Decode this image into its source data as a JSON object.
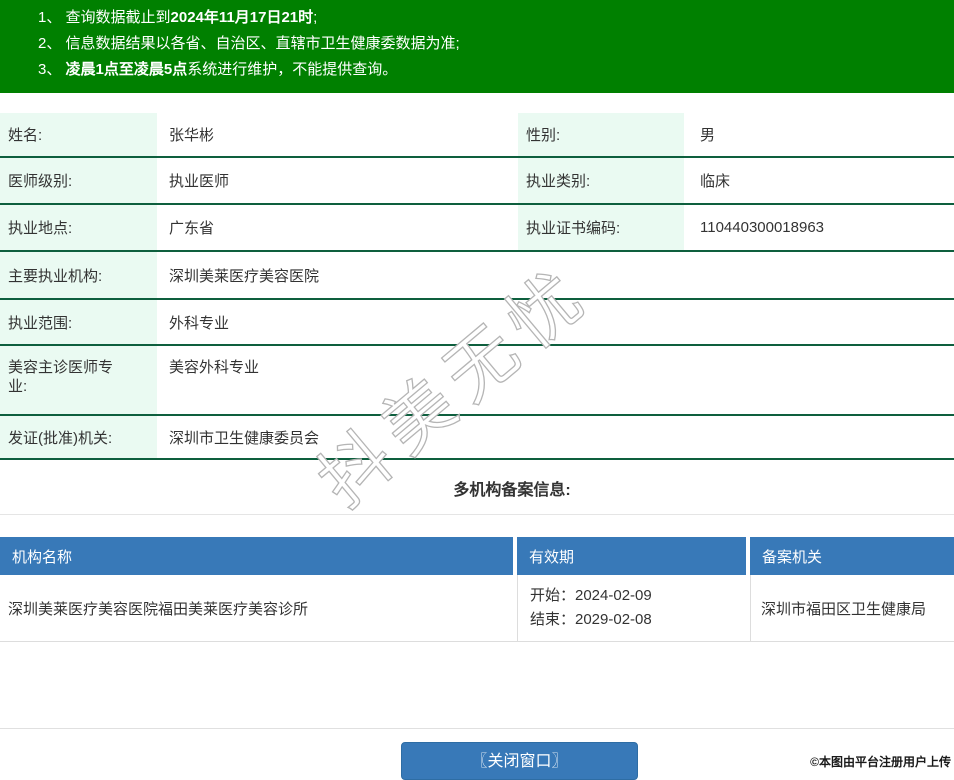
{
  "notices": {
    "items": [
      {
        "num": "1、",
        "pre": "查询数据截止到",
        "bold": "2024年11月17日21时",
        "post": ";"
      },
      {
        "num": "2、",
        "pre": "信息数据结果以各省、自治区、直辖市卫生健康委数据为准;",
        "bold": "",
        "post": ""
      },
      {
        "num": "3、",
        "pre": "",
        "bold": "凌晨1点至凌晨5点",
        "post": "系统进行维护，不能提供查询。"
      }
    ]
  },
  "doctor": {
    "rows": [
      {
        "l1": "姓名:",
        "v1": "张华彬",
        "l2": "性别:",
        "v2": "男"
      },
      {
        "l1": "医师级别:",
        "v1": "执业医师",
        "l2": "执业类别:",
        "v2": "临床"
      },
      {
        "l1": "执业地点:",
        "v1": "广东省",
        "l2": "执业证书编码:",
        "v2": "110440300018963"
      },
      {
        "l1": "主要执业机构:",
        "v1": "深圳美莱医疗美容医院"
      },
      {
        "l1": "执业范围:",
        "v1": "外科专业"
      },
      {
        "l1": "美容主诊医师专业:",
        "v1": "美容外科专业"
      },
      {
        "l1": "发证(批准)机关:",
        "v1": "深圳市卫生健康委员会"
      }
    ]
  },
  "watermark": {
    "text": "抖美无忧"
  },
  "multi_org": {
    "title": "多机构备案信息:",
    "columns": [
      "机构名称",
      "有效期",
      "备案机关"
    ],
    "rows": [
      {
        "org": "深圳美莱医疗美容医院福田美莱医疗美容诊所",
        "start": "开始：2024-02-09",
        "end": "结束：2029-02-08",
        "authority": "深圳市福田区卫生健康局"
      }
    ]
  },
  "footer": {
    "close_label": "〖关闭窗口〗",
    "upload_note": "©本图由平台注册用户上传"
  },
  "colors": {
    "banner_green": "#008000",
    "row_border_green": "#0e5f3e",
    "label_mint": "#eafaf2",
    "header_blue": "#3879b8",
    "light_border": "#dddddd"
  }
}
